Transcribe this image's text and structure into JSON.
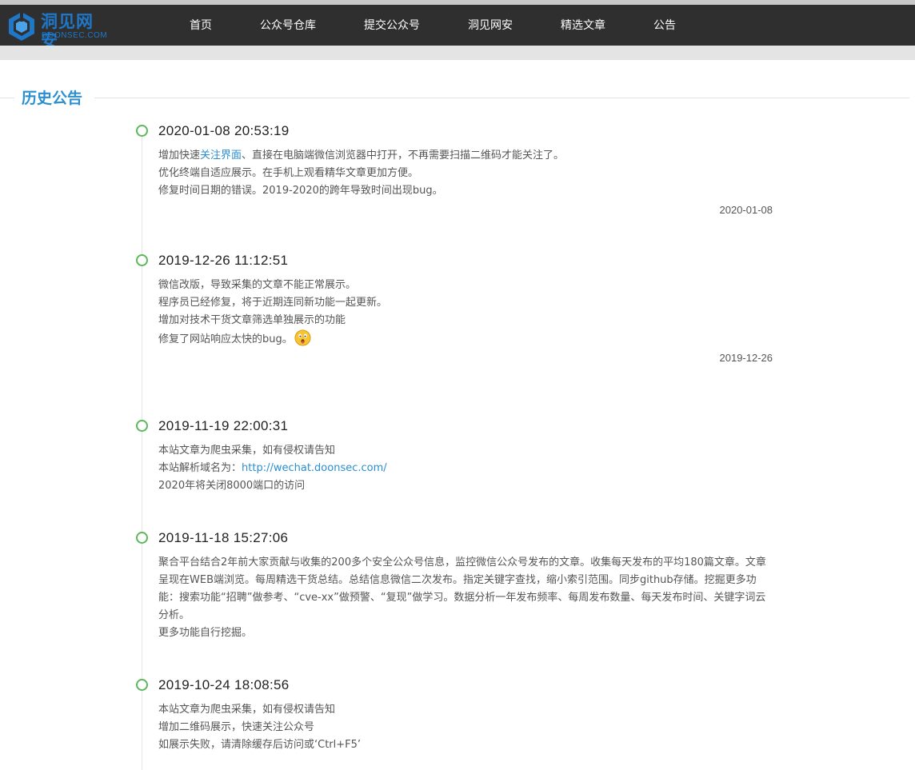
{
  "site": {
    "logo_cn": "洞见网安",
    "logo_en": "DOONSEC.COM"
  },
  "nav": {
    "items": [
      {
        "label": "首页"
      },
      {
        "label": "公众号仓库"
      },
      {
        "label": "提交公众号"
      },
      {
        "label": "洞见网安"
      },
      {
        "label": "精选文章"
      },
      {
        "label": "公告"
      }
    ]
  },
  "page": {
    "section_title": "历史公告"
  },
  "announcements": [
    {
      "title": "2020-01-08 20:53:19",
      "line1_pre": "增加快速",
      "line1_link": "关注界面",
      "line1_post": "、直接在电脑端微信浏览器中打开，不再需要扫描二维码才能关注了。",
      "line2": "优化终端自适应展示。在手机上观看精华文章更加方便。",
      "line3": "修复时间日期的错误。2019-2020的跨年导致时间出现bug。",
      "date": "2020-01-08"
    },
    {
      "title": "2019-12-26 11:12:51",
      "line1": "微信改版，导致采集的文章不能正常展示。",
      "line2": "程序员已经修复，将于近期连同新功能一起更新。",
      "line3": "增加对技术干货文章筛选单独展示的功能",
      "line4": "修复了网站响应太快的bug。",
      "emoji": "surprised-emoji",
      "date": "2019-12-26"
    },
    {
      "title": "2019-11-19 22:00:31",
      "line1": "本站文章为爬虫采集，如有侵权请告知",
      "line2_pre": "本站解析域名为：",
      "line2_link": "http://wechat.doonsec.com/",
      "line3": "2020年将关闭8000端口的访问"
    },
    {
      "title": "2019-11-18 15:27:06",
      "para": "聚合平台结合2年前大家贡献与收集的200多个安全公众号信息，监控微信公众号发布的文章。收集每天发布的平均180篇文章。文章呈现在WEB端浏览。每周精选干货总结。总结信息微信二次发布。指定关键字查找，缩小索引范围。同步github存储。挖掘更多功能：搜索功能“招聘”做参考、“cve-xx”做预警、“复现”做学习。数据分析一年发布频率、每周发布数量、每天发布时间、关键字词云分析。",
      "line2": "更多功能自行挖掘。"
    },
    {
      "title": "2019-10-24 18:08:56",
      "line1": "本站文章为爬虫采集，如有侵权请告知",
      "line2": "增加二维码展示，快速关注公众号",
      "line3": "如展示失败，请清除缓存后访问或‘Ctrl+F5’"
    }
  ],
  "colors": {
    "nav_bg": "#2f2f2f",
    "accent": "#2a8fd0",
    "dot": "#5cb85c"
  }
}
